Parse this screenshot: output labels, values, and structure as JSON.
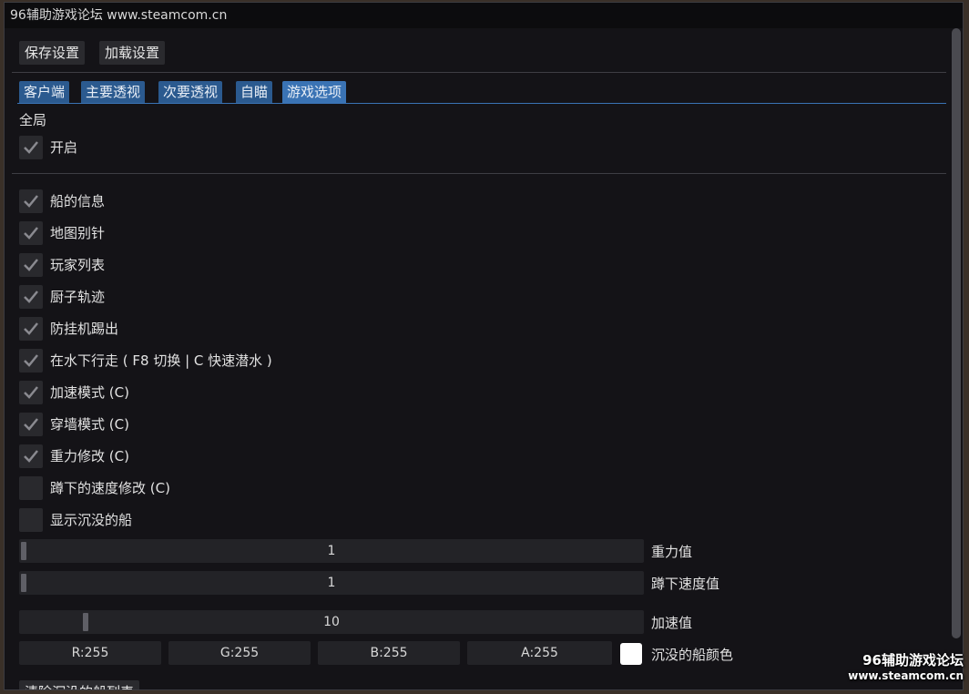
{
  "window": {
    "title": "96辅助游戏论坛 www.steamcom.cn"
  },
  "toolbar": {
    "save_label": "保存设置",
    "load_label": "加载设置"
  },
  "tabs": [
    {
      "label": "客户端",
      "active": false
    },
    {
      "label": "主要透视",
      "active": false
    },
    {
      "label": "次要透视",
      "active": false
    },
    {
      "label": "自瞄",
      "active": false
    },
    {
      "label": "游戏选项",
      "active": true
    }
  ],
  "global": {
    "heading": "全局",
    "enable": {
      "label": "开启",
      "checked": true
    }
  },
  "options": [
    {
      "label": "船的信息",
      "checked": true
    },
    {
      "label": "地图别针",
      "checked": true
    },
    {
      "label": "玩家列表",
      "checked": true
    },
    {
      "label": "厨子轨迹",
      "checked": true
    },
    {
      "label": "防挂机踢出",
      "checked": true
    },
    {
      "label": "在水下行走 ( F8 切换 | C 快速潜水 )",
      "checked": true
    },
    {
      "label": "加速模式 (C)",
      "checked": true
    },
    {
      "label": "穿墙模式 (C)",
      "checked": true
    },
    {
      "label": "重力修改 (C)",
      "checked": true
    },
    {
      "label": "蹲下的速度修改 (C)",
      "checked": false
    },
    {
      "label": "显示沉没的船",
      "checked": false
    }
  ],
  "sliders": [
    {
      "value": "1",
      "label": "重力值",
      "fraction": 0.0
    },
    {
      "value": "1",
      "label": "蹲下速度值",
      "fraction": 0.0
    },
    {
      "value": "10",
      "label": "加速值",
      "fraction": 0.1
    }
  ],
  "color": {
    "r": "R:255",
    "g": "G:255",
    "b": "B:255",
    "a": "A:255",
    "label": "沉没的船颜色",
    "swatch": "#ffffff"
  },
  "bottom_button": "清除沉没的船列表",
  "watermark": {
    "line1": "96辅助游戏论坛",
    "line2": "www.steamcom.cn"
  },
  "colors": {
    "accent": "#3a73b4",
    "tab": "#2b5a8f",
    "background": "#141317"
  }
}
